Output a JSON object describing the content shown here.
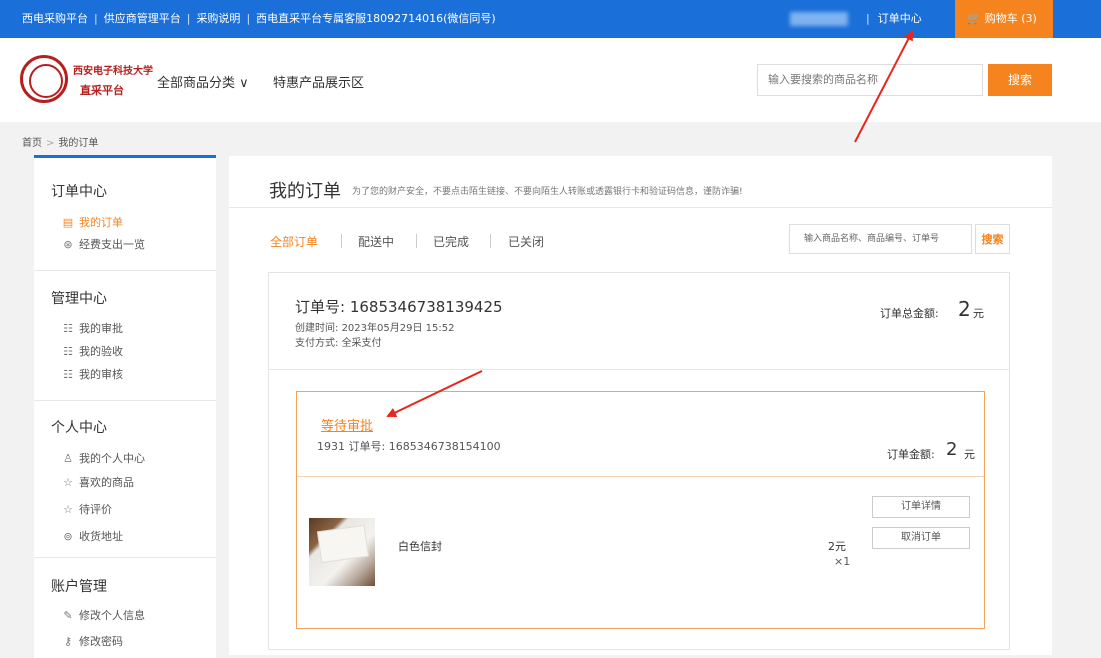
{
  "topbar": {
    "links": [
      "西电采购平台",
      "供应商管理平台",
      "采购说明",
      "西电直采平台专属客服18092714016(微信同号)"
    ],
    "separator": "|",
    "order_center": "订单中心",
    "cart": "购物车 (3)"
  },
  "header": {
    "logo_line1": "西安电子科技大学",
    "logo_line2": "直采平台",
    "nav_category": "全部商品分类",
    "nav_special": "特惠产品展示区",
    "search_placeholder": "输入要搜索的商品名称",
    "search_button": "搜索"
  },
  "breadcrumb": {
    "home": "首页",
    "sep": ">",
    "current": "我的订单"
  },
  "sidebar": {
    "sections": [
      {
        "title": "订单中心",
        "items": [
          "我的订单",
          "经费支出一览"
        ]
      },
      {
        "title": "管理中心",
        "items": [
          "我的审批",
          "我的验收",
          "我的审核"
        ]
      },
      {
        "title": "个人中心",
        "items": [
          "我的个人中心",
          "喜欢的商品",
          "待评价",
          "收货地址"
        ]
      },
      {
        "title": "账户管理",
        "items": [
          "修改个人信息",
          "修改密码"
        ]
      }
    ]
  },
  "main": {
    "title": "我的订单",
    "notice": "为了您的财产安全，不要点击陌生链接、不要向陌生人转账或透露银行卡和验证码信息，谨防诈骗!",
    "tabs": [
      "全部订单",
      "配送中",
      "已完成",
      "已关闭"
    ],
    "order_search_placeholder": "输入商品名称、商品编号、订单号",
    "order_search_button": "搜索"
  },
  "order": {
    "number_label": "订单号:",
    "number": "1685346738139425",
    "created_label": "创建时间:",
    "created": "2023年05月29日 15:52",
    "pay_label": "支付方式:",
    "pay": "全采支付",
    "total_label": "订单总金额:",
    "total_value": "2",
    "total_unit": "元",
    "sub": {
      "status": "等待审批",
      "prefix": "1931 订单号:",
      "number": "1685346738154100",
      "amount_label": "订单金额:",
      "amount_value": "2",
      "amount_unit": "元",
      "product_name": "白色信封",
      "product_price": "2元",
      "product_qty": "×1",
      "detail_button": "订单详情",
      "cancel_button": "取消订单"
    }
  },
  "colors": {
    "primary_blue": "#1a6fd8",
    "accent_orange": "#f5841f",
    "annotation_red": "#e8261c"
  }
}
